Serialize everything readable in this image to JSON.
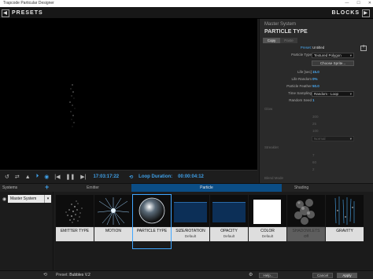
{
  "window": {
    "title": "Trapcode Particular Designer",
    "minimize": "—",
    "maximize": "☐",
    "close": "✕"
  },
  "header": {
    "presets_label": "PRESETS",
    "blocks_label": "BLOCKS",
    "left_arrow": "◀",
    "right_arrow": "▶"
  },
  "transport": {
    "icons": [
      "↺",
      "⇄",
      "▲",
      "⏵",
      "◉",
      "|◀",
      "❚❚",
      "▶|"
    ],
    "timecode": "17:03:17:22",
    "loop_icon": "⟲",
    "loop_label": "Loop Duration:",
    "loop_value": "00:00:04:12"
  },
  "inspector": {
    "section": "Master System",
    "title": "PARTICLE TYPE",
    "tabs": [
      "Copy",
      "Paste"
    ],
    "rows": {
      "preset": {
        "label": "Preset:",
        "value": "Untitled"
      },
      "particle_type": {
        "label": "Particle Type",
        "value": "Textured Polygon"
      },
      "choose_sprite": "Choose Sprite...",
      "life": {
        "label": "Life [sec]",
        "value": "15.0"
      },
      "life_random": {
        "label": "Life Random",
        "value": "0%"
      },
      "feather": {
        "label": "Particle Feather",
        "value": "50.0"
      },
      "time_sampling": {
        "label": "Time Sampling",
        "value": "Random - Loop"
      },
      "random_seed": {
        "label": "Random Seed",
        "value": "1"
      }
    },
    "glow_label": "Glow",
    "glow_values": [
      "300",
      "25",
      "100"
    ],
    "glow_blend": "Normal",
    "streaklet_label": "Streaklet",
    "streaklet_values": [
      "7",
      "60",
      "2"
    ],
    "blend_label": "Blend Mode"
  },
  "blockbar": {
    "systems_label": "Systems",
    "add_icon": "+",
    "groups": [
      "Emitter",
      "Particle",
      "Shading"
    ]
  },
  "systems": {
    "eye_icon": "◉",
    "system_name": "Master System",
    "dropdown": "▾"
  },
  "blocks": [
    {
      "label": "EMITTER TYPE",
      "sub": ""
    },
    {
      "label": "MOTION",
      "sub": ""
    },
    {
      "label": "PARTICLE TYPE",
      "sub": ""
    },
    {
      "label": "SIZE/ROTATION",
      "sub": "Default"
    },
    {
      "label": "OPACITY",
      "sub": "Default"
    },
    {
      "label": "COLOR",
      "sub": "Default"
    },
    {
      "label": "SHADOWLETS",
      "sub": "Off"
    },
    {
      "label": "GRAVITY",
      "sub": ""
    }
  ],
  "status": {
    "undo_icon": "⟲",
    "preset_label": "Preset:",
    "preset_value": "Bubbles V.2",
    "gear_icon": "⚙",
    "help": "Help...",
    "cancel": "Cancel",
    "apply": "Apply"
  }
}
